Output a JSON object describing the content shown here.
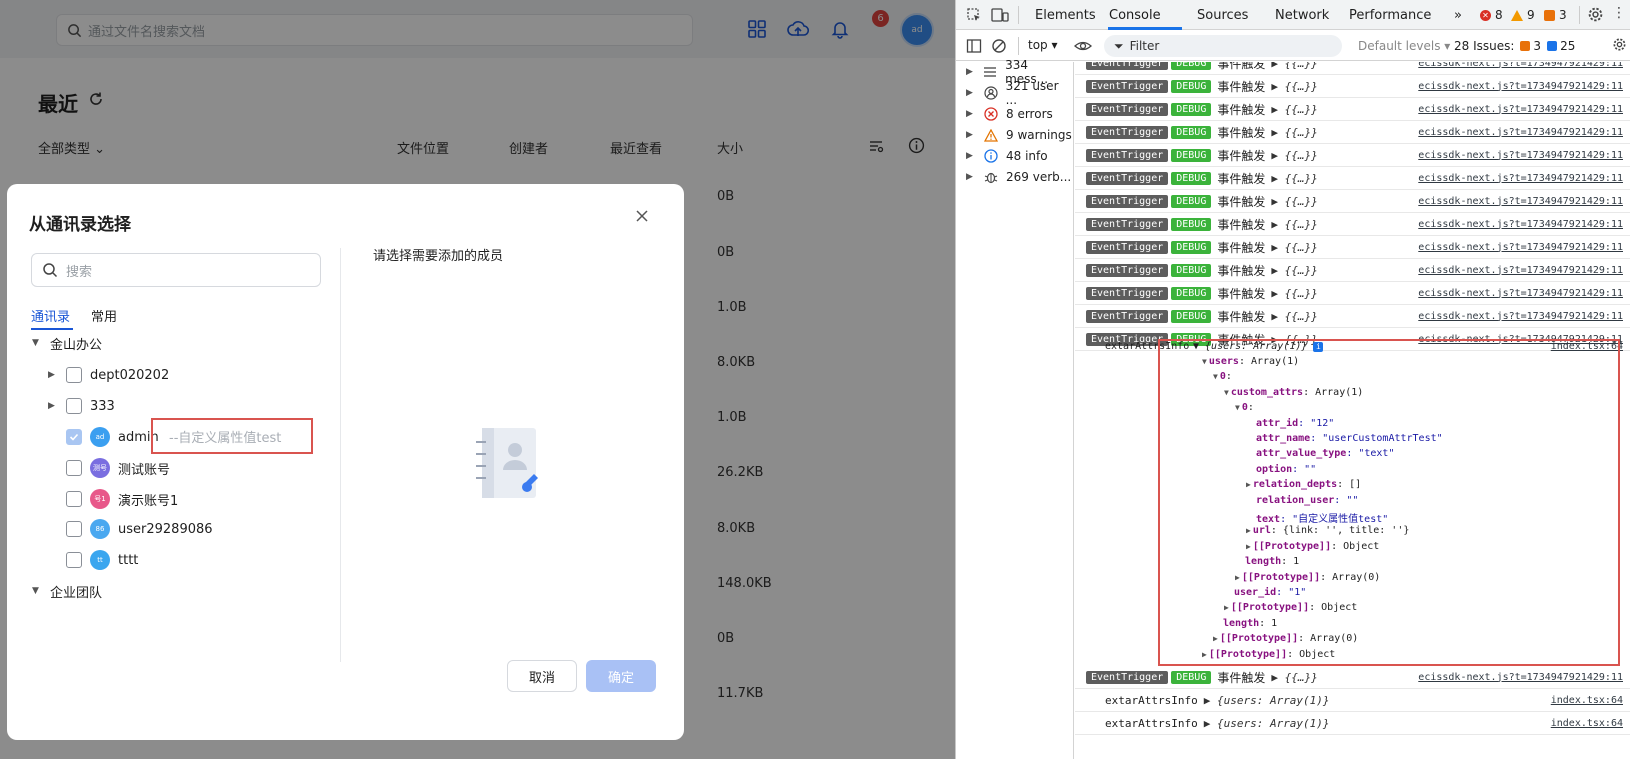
{
  "app": {
    "search_placeholder": "通过文件名搜索文档",
    "notification_count": "6",
    "avatar_text": "ad",
    "page_title": "最近",
    "filter_type": "全部类型",
    "columns": [
      "文件位置",
      "创建者",
      "最近查看",
      "大小"
    ],
    "sizes": [
      "0B",
      "0B",
      "1.0B",
      "8.0KB",
      "1.0B",
      "26.2KB",
      "8.0KB",
      "148.0KB",
      "0B",
      "11.7KB"
    ]
  },
  "dialog": {
    "title": "从通讯录选择",
    "search_placeholder": "搜索",
    "tabs": [
      "通讯录",
      "常用"
    ],
    "groups": [
      {
        "label": "金山办公"
      },
      {
        "label": "企业团队"
      }
    ],
    "members": [
      {
        "label": "dept020202",
        "type": "dept"
      },
      {
        "label": "333",
        "type": "dept"
      },
      {
        "label": "admin",
        "avatar": "ad",
        "avatar_color": "#3b9ff0",
        "checked": true
      },
      {
        "label": "测试账号",
        "avatar": "测号",
        "avatar_color": "#7a6ee0"
      },
      {
        "label": "演示账号1",
        "avatar": "号1",
        "avatar_color": "#e8588a"
      },
      {
        "label": "user29289086",
        "avatar": "86",
        "avatar_color": "#4aa8f0"
      },
      {
        "label": "tttt",
        "avatar": "tt",
        "avatar_color": "#3aa6ef"
      }
    ],
    "custom_attr_text": "--自定义属性值test",
    "right_hint": "请选择需要添加的成员",
    "cancel_label": "取消",
    "ok_label": "确定"
  },
  "devtools": {
    "tabs": [
      "Elements",
      "Console",
      "Sources",
      "Network",
      "Performance"
    ],
    "more": "»",
    "errors_count": "8",
    "warnings_count": "9",
    "issues_count": "3",
    "context": "top",
    "filter_placeholder": "Filter",
    "levels": "Default levels",
    "issues_label": "28 Issues:",
    "issues_red": "3",
    "issues_blue": "25",
    "sidebar": [
      {
        "label": "334 mess...",
        "icon": "list-icon"
      },
      {
        "label": "321 user ...",
        "icon": "user-icon"
      },
      {
        "label": "8 errors",
        "icon": "error-icon"
      },
      {
        "label": "9 warnings",
        "icon": "warning-icon"
      },
      {
        "label": "48 info",
        "icon": "info-icon"
      },
      {
        "label": "269 verb...",
        "icon": "bug-icon"
      }
    ],
    "log_tag": "EventTrigger",
    "log_level": "DEBUG",
    "log_event": "事件触发",
    "log_obj": "▶ {{…}}",
    "log_src": "ecissdk-next.js?t=1734947921429:11",
    "extra_label": "extarAttrsInfo",
    "extra_obj": "▶ {users: Array(1)}",
    "extra_obj_open": "▼ {users: Array(1)}",
    "extra_src": "index.tsx:64",
    "tree": [
      {
        "indent": 0,
        "text": "users",
        "val": ": Array(1)",
        "open": "▼"
      },
      {
        "indent": 1,
        "text": "0",
        "val": ":",
        "open": "▼"
      },
      {
        "indent": 2,
        "text": "custom_attrs",
        "val": ": Array(1)",
        "open": "▼"
      },
      {
        "indent": 3,
        "text": "0",
        "val": ":",
        "open": "▼"
      },
      {
        "indent": 4,
        "text": "attr_id",
        "val": ": \"12\"",
        "open": ""
      },
      {
        "indent": 4,
        "text": "attr_name",
        "val": ": \"userCustomAttrTest\"",
        "open": ""
      },
      {
        "indent": 4,
        "text": "attr_value_type",
        "val": ": \"text\"",
        "open": ""
      },
      {
        "indent": 4,
        "text": "option",
        "val": ": \"\"",
        "open": ""
      },
      {
        "indent": 4,
        "text": "relation_depts",
        "val": ": []",
        "open": "▶"
      },
      {
        "indent": 4,
        "text": "relation_user",
        "val": ": \"\"",
        "open": ""
      },
      {
        "indent": 4,
        "text": "text",
        "val": ": \"自定义属性值test\"",
        "open": ""
      },
      {
        "indent": 4,
        "text": "url",
        "val": ": {link: '', title: ''}",
        "open": "▶"
      },
      {
        "indent": 4,
        "text": "[[Prototype]]",
        "val": ": Object",
        "open": "▶"
      },
      {
        "indent": 3,
        "text": "length",
        "val": ": 1",
        "open": ""
      },
      {
        "indent": 3,
        "text": "[[Prototype]]",
        "val": ": Array(0)",
        "open": "▶"
      },
      {
        "indent": 2,
        "text": "user_id",
        "val": ": \"1\"",
        "open": ""
      },
      {
        "indent": 2,
        "text": "[[Prototype]]",
        "val": ": Object",
        "open": "▶"
      },
      {
        "indent": 1,
        "text": "length",
        "val": ": 1",
        "open": ""
      },
      {
        "indent": 1,
        "text": "[[Prototype]]",
        "val": ": Array(0)",
        "open": "▶"
      },
      {
        "indent": 0,
        "text": "[[Prototype]]",
        "val": ": Object",
        "open": "▶"
      }
    ]
  }
}
